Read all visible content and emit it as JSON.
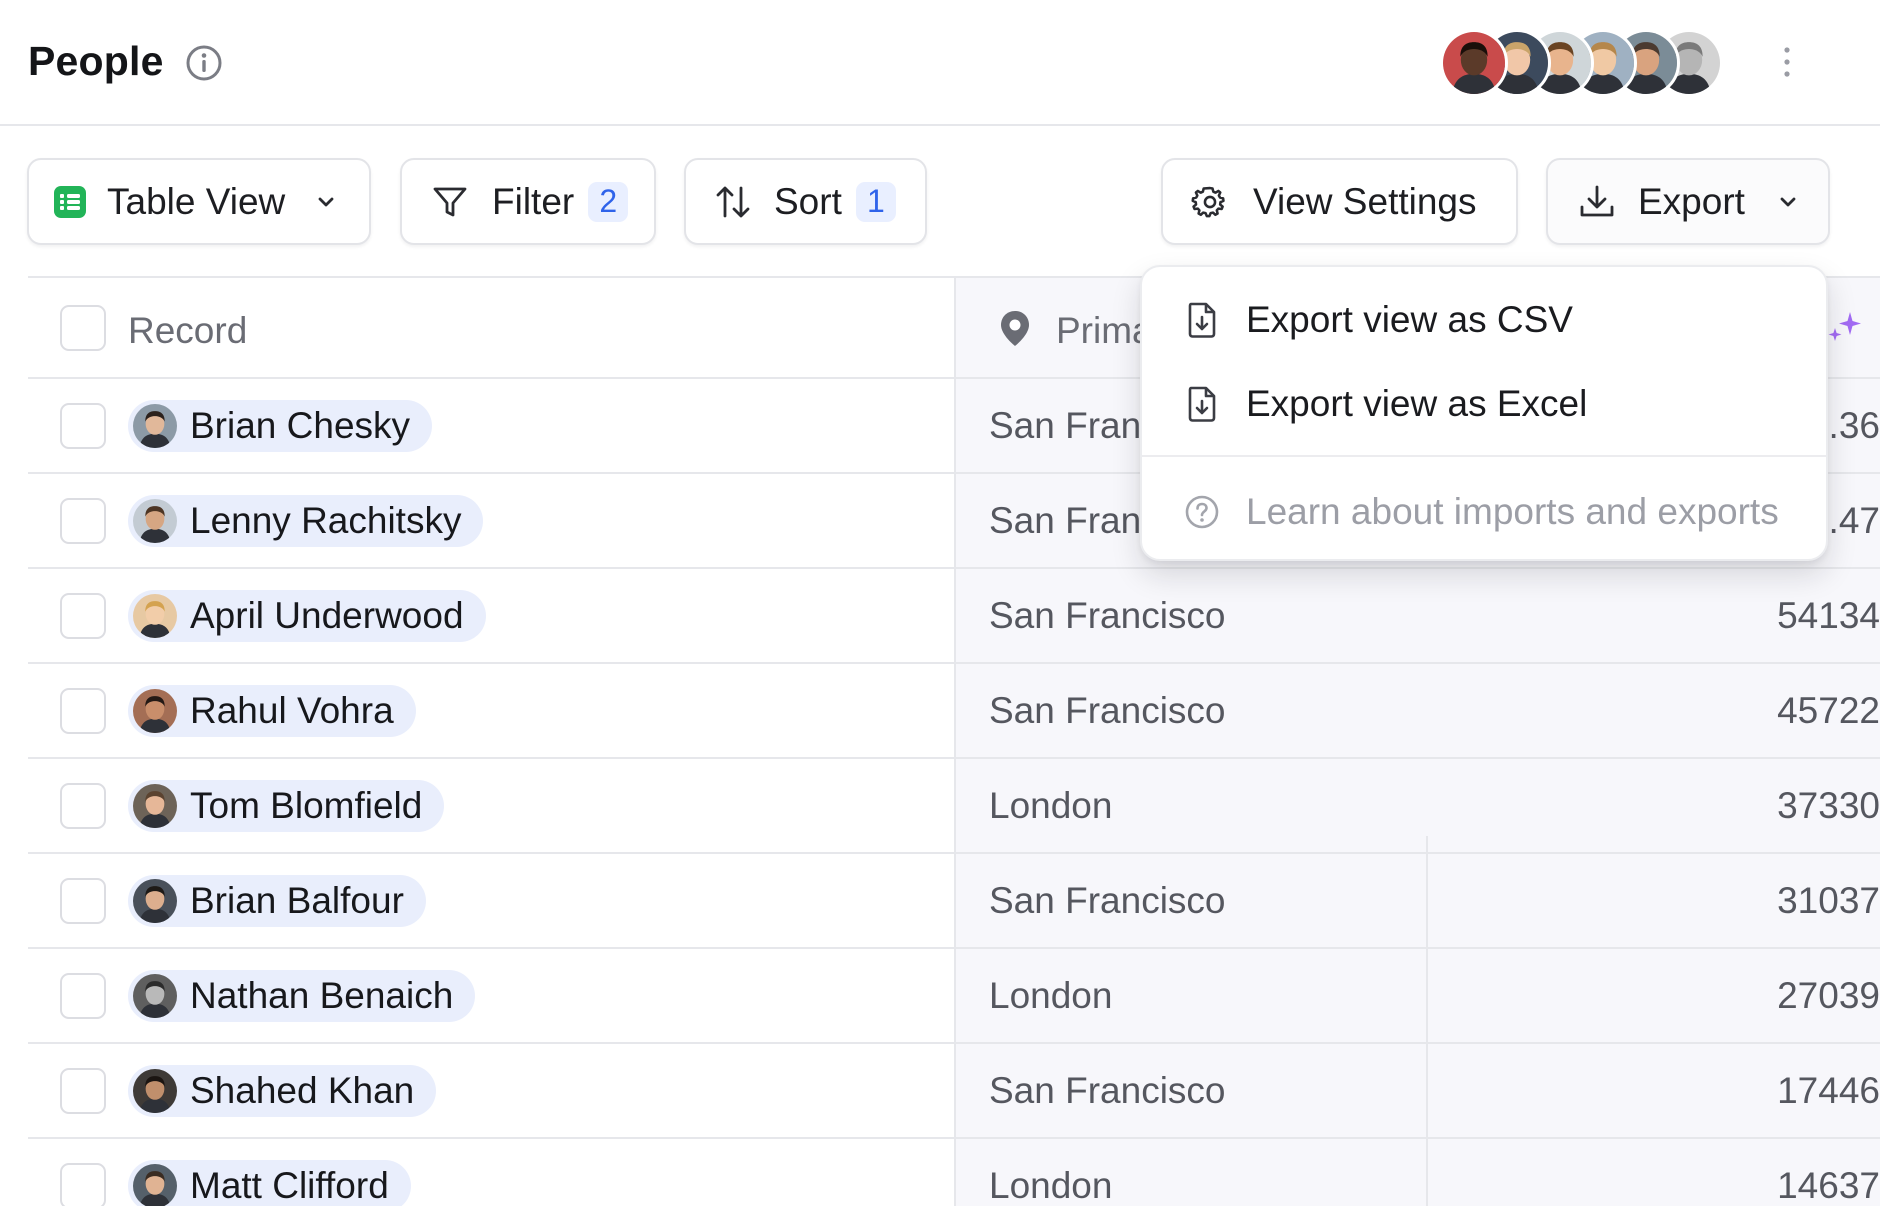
{
  "header": {
    "title": "People",
    "info_icon": "info-icon",
    "collaborators": [
      {
        "name": "collaborator-1",
        "bg": "#c94b4b",
        "skin": "#5b3a29",
        "hair": "#1a0f0a"
      },
      {
        "name": "collaborator-2",
        "bg": "#3c4a5d",
        "skin": "#f1c7a8",
        "hair": "#c9a46a"
      },
      {
        "name": "collaborator-3",
        "bg": "#cfd6d9",
        "skin": "#e8b48d",
        "hair": "#6a4423"
      },
      {
        "name": "collaborator-4",
        "bg": "#9fb1c2",
        "skin": "#f0c9a4",
        "hair": "#b5874b"
      },
      {
        "name": "collaborator-5",
        "bg": "#7b8c97",
        "skin": "#d9a37f",
        "hair": "#4b3a30"
      },
      {
        "name": "collaborator-6",
        "bg": "#d3d3d3",
        "skin": "#b5b5b5",
        "hair": "#7a7a7a"
      }
    ],
    "more_icon": "more-vertical-icon"
  },
  "toolbar": {
    "view_label": "Table View",
    "filter_label": "Filter",
    "filter_count": "2",
    "sort_label": "Sort",
    "sort_count": "1",
    "view_settings_label": "View Settings",
    "export_label": "Export"
  },
  "table": {
    "record_header": "Record",
    "location_header": "Primary location",
    "rows": [
      {
        "name": "Brian Chesky",
        "location": "San Francisco",
        "value": "...36",
        "bg": "#8c9aa6",
        "skin": "#e1b89a",
        "hair": "#2b211c"
      },
      {
        "name": "Lenny Rachitsky",
        "location": "San Francisco",
        "value": "...47",
        "bg": "#c3cbd3",
        "skin": "#d6a683",
        "hair": "#4d3524"
      },
      {
        "name": "April Underwood",
        "location": "San Francisco",
        "value": "54134",
        "bg": "#e7c9a3",
        "skin": "#f2cda9",
        "hair": "#d4a24f"
      },
      {
        "name": "Rahul Vohra",
        "location": "San Francisco",
        "value": "45722",
        "bg": "#a46e55",
        "skin": "#c98e6b",
        "hair": "#241915"
      },
      {
        "name": "Tom Blomfield",
        "location": "London",
        "value": "37330",
        "bg": "#6d6358",
        "skin": "#e6b798",
        "hair": "#5b4330"
      },
      {
        "name": "Brian Balfour",
        "location": "San Francisco",
        "value": "31037",
        "bg": "#49505a",
        "skin": "#dcae8e",
        "hair": "#1e1a17"
      },
      {
        "name": "Nathan Benaich",
        "location": "London",
        "value": "27039",
        "bg": "#5f5f5f",
        "skin": "#b9b9b9",
        "hair": "#2c2c2c"
      },
      {
        "name": "Shahed Khan",
        "location": "San Francisco",
        "value": "17446",
        "bg": "#3e3a37",
        "skin": "#c08f6c",
        "hair": "#1b1512"
      },
      {
        "name": "Matt Clifford",
        "location": "London",
        "value": "14637",
        "bg": "#55606a",
        "skin": "#e0b393",
        "hair": "#3a2c22"
      }
    ]
  },
  "export_menu": {
    "csv_label": "Export view as CSV",
    "excel_label": "Export view as Excel",
    "learn_label": "Learn about imports and exports"
  },
  "colors": {
    "accent": "#2f63ea",
    "chip_bg": "#e9eefc",
    "table_view_icon": "#22b458",
    "sparkle": "#a26bf3"
  }
}
